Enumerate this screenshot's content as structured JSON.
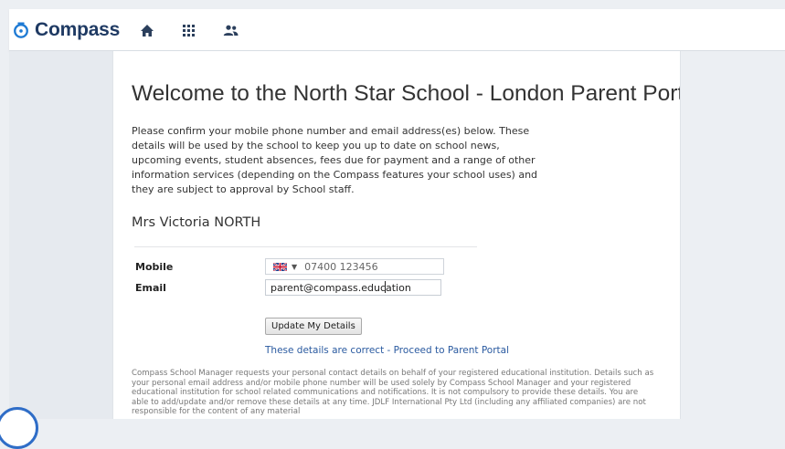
{
  "app": {
    "name": "Compass",
    "brand_color": "#1f3a63",
    "accent_color": "#1e7ad4"
  },
  "topnav": {
    "icons": [
      "home-icon",
      "apps-grid-icon",
      "people-icon"
    ]
  },
  "main": {
    "title": "Welcome to the North Star School - London Parent Portal",
    "intro": "Please confirm your mobile phone number and email address(es) below. These details will be used by the school to keep you up to date on school news, upcoming events, student absences, fees due for payment and a range of other information services (depending on the Compass features your school uses) and they are subject to approval by School staff.",
    "parent_name": "Mrs Victoria NORTH",
    "mobile": {
      "label": "Mobile",
      "country_flag": "gb-flag-icon",
      "value": "07400 123456"
    },
    "email": {
      "label": "Email",
      "value": "parent@compass.education"
    },
    "update_button": "Update My Details",
    "proceed_link": "These details are correct - Proceed to Parent Portal",
    "fineprint": "Compass School Manager requests your personal contact details on behalf of your registered educational institution. Details such as your personal email address and/or mobile phone number will be used solely by Compass School Manager and your registered educational institution for school related communications and notifications. It is not compulsory to provide these details. You are able to add/update and/or remove these details at any time. JDLF International Pty Ltd (including any affiliated companies) are not responsible for the content of any material"
  }
}
